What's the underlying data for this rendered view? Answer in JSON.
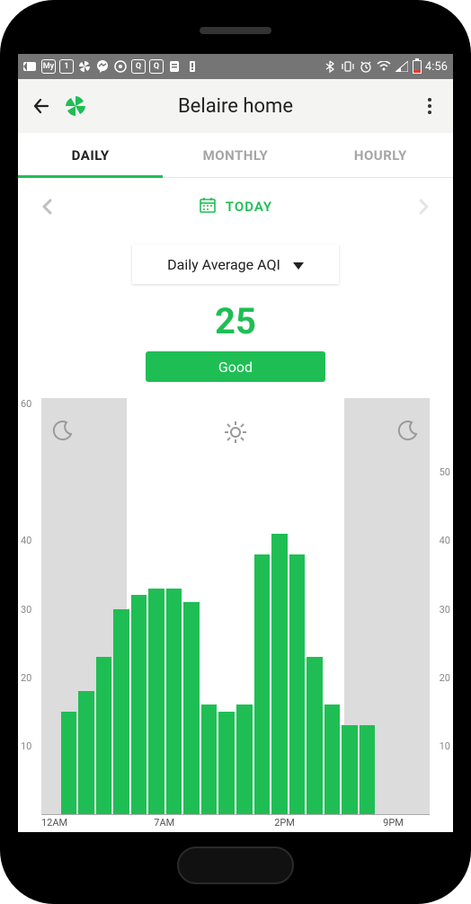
{
  "status_bar": {
    "time": "4:56"
  },
  "header": {
    "title": "Belaire home"
  },
  "tabs": [
    {
      "label": "DAILY",
      "active": true
    },
    {
      "label": "MONTHLY",
      "active": false
    },
    {
      "label": "HOURLY",
      "active": false
    }
  ],
  "date_nav": {
    "label": "TODAY"
  },
  "dropdown": {
    "selected": "Daily Average AQI"
  },
  "aqi": {
    "value": "25",
    "status": "Good"
  },
  "chart_data": {
    "type": "bar",
    "ylim": [
      0,
      60
    ],
    "y_ticks_left": [
      60,
      40,
      30,
      20,
      10
    ],
    "y_ticks_right": [
      50,
      40,
      30,
      20,
      10
    ],
    "x_labels": [
      "12AM",
      "7AM",
      "2PM",
      "9PM"
    ],
    "x_label_positions": [
      0,
      29,
      60,
      88
    ],
    "values": [
      15,
      18,
      23,
      30,
      32,
      33,
      33,
      31,
      16,
      15,
      16,
      38,
      41,
      38,
      23,
      16,
      13,
      13
    ],
    "night_left_pct": 22,
    "night_right_pct": 22
  }
}
